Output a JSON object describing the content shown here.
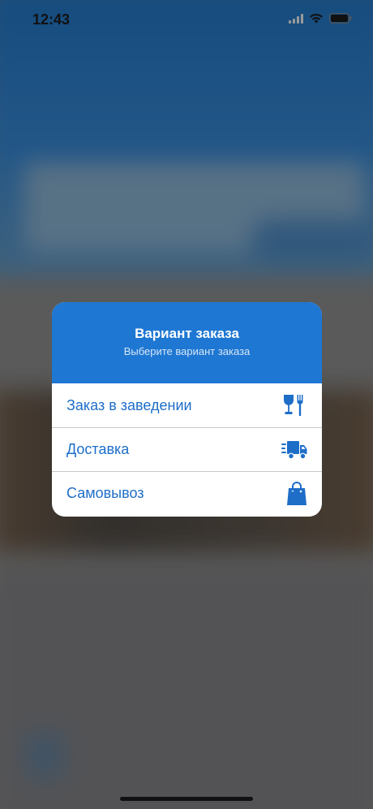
{
  "status_bar": {
    "time": "12:43",
    "icons": [
      "cellular-signal-icon",
      "wifi-icon",
      "battery-icon"
    ]
  },
  "dialog": {
    "title": "Вариант заказа",
    "subtitle": "Выберите вариант заказа",
    "header_color": "#1e77d2",
    "accent_color": "#1e6ec8",
    "options": [
      {
        "label": "Заказ в заведении",
        "icon": "dine-in-icon"
      },
      {
        "label": "Доставка",
        "icon": "delivery-truck-icon"
      },
      {
        "label": "Самовывоз",
        "icon": "shopping-bag-icon"
      }
    ]
  }
}
